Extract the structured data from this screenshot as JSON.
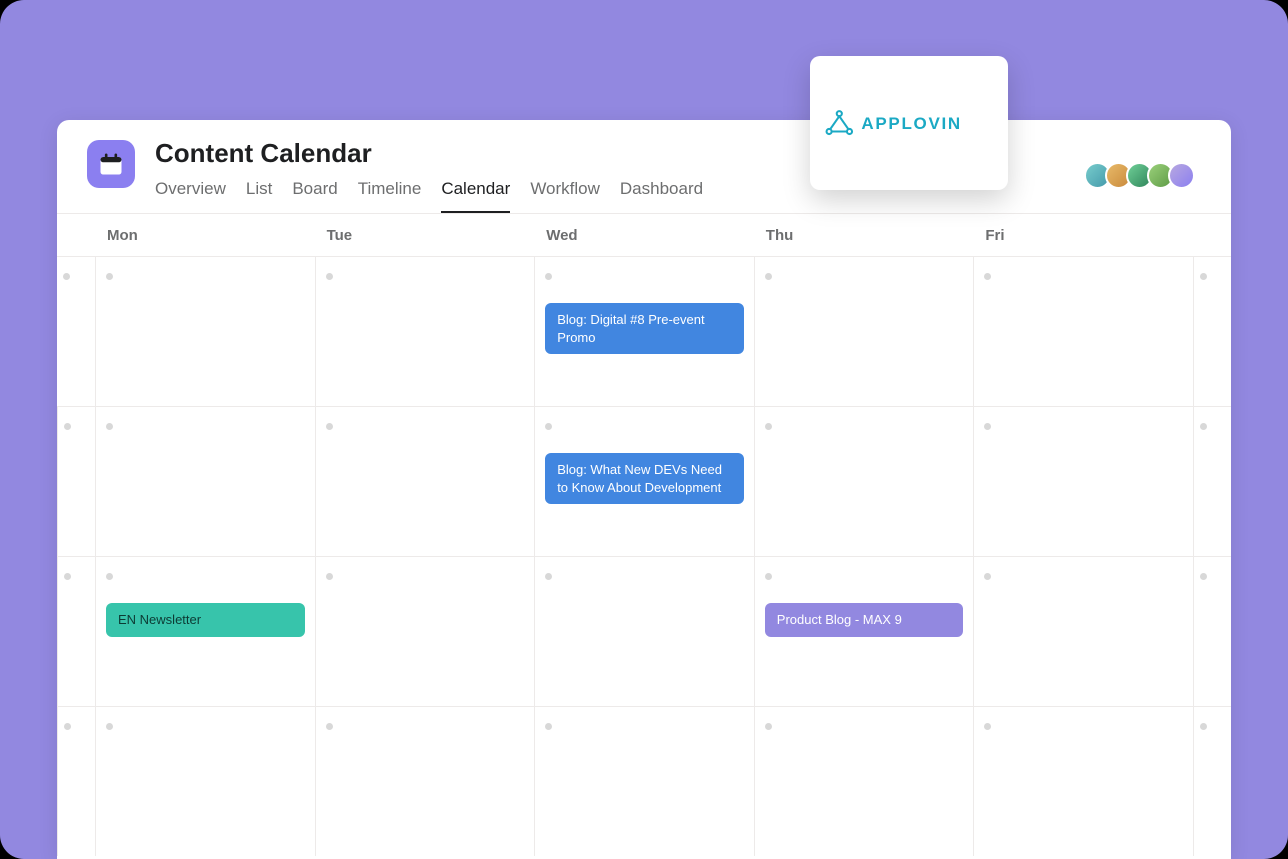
{
  "header": {
    "title": "Content Calendar",
    "tabs": [
      {
        "label": "Overview",
        "active": false
      },
      {
        "label": "List",
        "active": false
      },
      {
        "label": "Board",
        "active": false
      },
      {
        "label": "Timeline",
        "active": false
      },
      {
        "label": "Calendar",
        "active": true
      },
      {
        "label": "Workflow",
        "active": false
      },
      {
        "label": "Dashboard",
        "active": false
      }
    ]
  },
  "logo": {
    "brand": "APPLOVIN"
  },
  "calendar": {
    "day_headers": [
      "Mon",
      "Tue",
      "Wed",
      "Thu",
      "Fri"
    ],
    "events": {
      "r0_wed": "Blog: Digital #8 Pre-event Promo",
      "r1_wed": "Blog: What New DEVs Need to Know About Development",
      "r2_mon": "EN Newsletter",
      "r2_thu": "Product Blog - MAX 9"
    }
  },
  "colors": {
    "page_bg": "#9288e0",
    "event_blue": "#4186e0",
    "event_teal": "#37c4ab",
    "event_purple": "#9288e0"
  }
}
